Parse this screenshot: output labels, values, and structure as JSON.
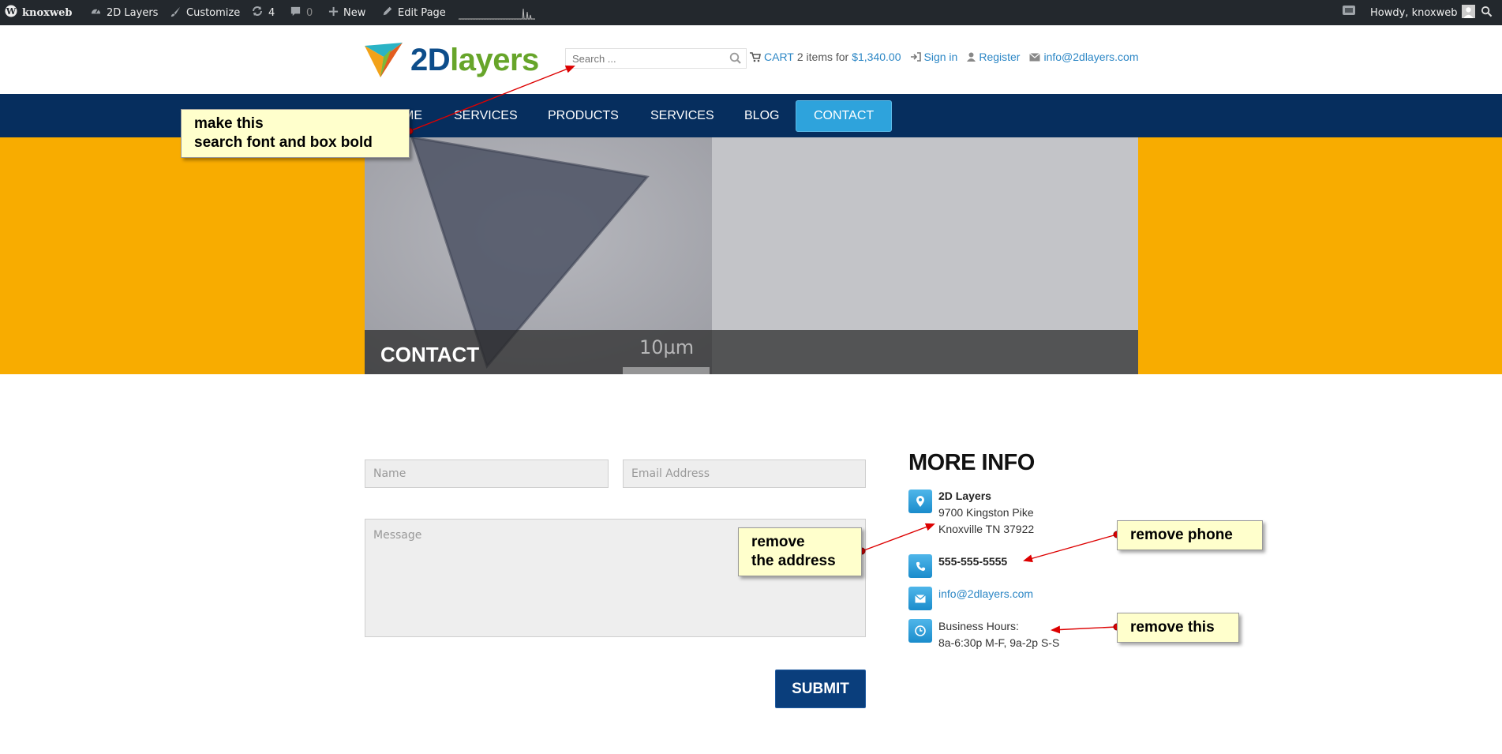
{
  "adminbar": {
    "site_owner": "knoxweb",
    "site_name": "2D Layers",
    "customize": "Customize",
    "updates_count": "4",
    "comments_count": "0",
    "new_label": "New",
    "edit_page": "Edit Page",
    "howdy": "Howdy, knoxweb"
  },
  "header": {
    "logo_part1": "2D",
    "logo_part2": "layers",
    "search_placeholder": "Search ...",
    "cart_label": "CART",
    "cart_items": "2 items for",
    "cart_total": "$1,340.00",
    "sign_in": "Sign in",
    "register": "Register",
    "email": "info@2dlayers.com"
  },
  "nav": {
    "items": [
      "HOME",
      "SERVICES",
      "PRODUCTS",
      "SERVICES",
      "BLOG",
      "CONTACT"
    ],
    "active": "CONTACT"
  },
  "hero": {
    "title": "CONTACT",
    "scale_label": "10µm"
  },
  "form": {
    "name_placeholder": "Name",
    "email_placeholder": "Email Address",
    "message_placeholder": "Message",
    "submit": "SUBMIT"
  },
  "more_info": {
    "title": "MORE INFO",
    "company": "2D Layers",
    "address1": "9700 Kingston Pike",
    "address2": "Knoxville TN 37922",
    "phone": "555-555-5555",
    "email": "info@2dlayers.com",
    "hours_label": "Business Hours:",
    "hours": "8a-6:30p M-F, 9a-2p S-S"
  },
  "annotations": {
    "search_note_line1": "make this",
    "search_note_line2": "search font and box bold",
    "address_note_line1": "remove",
    "address_note_line2": "the address",
    "phone_note": "remove phone",
    "hours_note": "remove this"
  },
  "colors": {
    "adminbar": "#23282d",
    "nav": "#062e5e",
    "hero_bg": "#f8ac00",
    "accent": "#2ea3dc",
    "link": "#2b86c5",
    "submit": "#0a3e7c",
    "annotation": "#ffffcc",
    "arrow": "#dd0000"
  }
}
